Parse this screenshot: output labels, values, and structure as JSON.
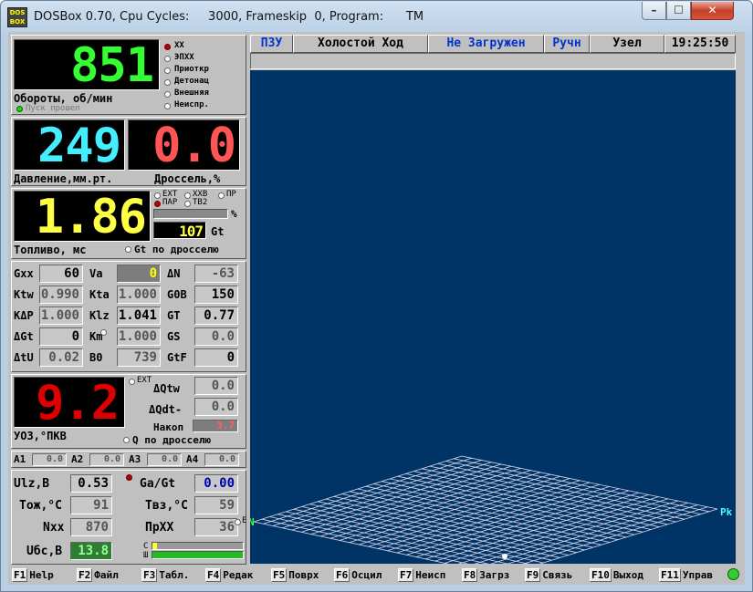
{
  "window": {
    "title": "DOSBox 0.70, Cpu Cycles:     3000, Frameskip  0, Program:      TM",
    "icon_text": "DOS BOX",
    "minimize": "–",
    "maximize": "☐",
    "close": "✕"
  },
  "rpm": {
    "value": "851",
    "label": "Обороты, об/мин",
    "start_label": "Пуск прошел"
  },
  "modes": [
    "ХХ",
    "ЭПХХ",
    "Приоткр",
    "Детонац",
    "Внешняя",
    "Неиспр."
  ],
  "pressure": {
    "value": "249",
    "label": "Давление,мм.рт."
  },
  "throttle": {
    "value": "0.0",
    "label": "Дроссель,%"
  },
  "fuel": {
    "value": "1.86",
    "label": "Топливо, мс",
    "options": [
      "EXT",
      "ХХВ",
      "ПР",
      "ПАР",
      "ТВ2"
    ],
    "percent_sign": "%",
    "gt_value": "107",
    "gt_label": "Gt",
    "gt_throttle": "Gt по дросселю"
  },
  "params": [
    {
      "label": "Gxx",
      "value": "60"
    },
    {
      "label": "Va",
      "value": "0"
    },
    {
      "label": "ΔN",
      "value": "-63"
    },
    {
      "label": "Ktw",
      "value": "0.990"
    },
    {
      "label": "Kta",
      "value": "1.000"
    },
    {
      "label": "G0B",
      "value": "150"
    },
    {
      "label": "KΔP",
      "value": "1.000"
    },
    {
      "label": "Klz",
      "value": "1.041"
    },
    {
      "label": "GT",
      "value": "0.77"
    },
    {
      "label": "ΔGt",
      "value": "0"
    },
    {
      "label": "Km",
      "value": "1.000"
    },
    {
      "label": "GS",
      "value": "0.0"
    },
    {
      "label": "ΔtU",
      "value": "0.02"
    },
    {
      "label": "B0",
      "value": "739"
    },
    {
      "label": "GtF",
      "value": "0"
    }
  ],
  "ignition": {
    "value": "9.2",
    "label": "УОЗ,°ПКВ",
    "ext": "EXT",
    "dqtw_label": "ΔQtw",
    "dqtw": "0.0",
    "dqdt_label": "ΔQdt-",
    "dqdt": "0.0",
    "nakop_label": "Накоп",
    "nakop": "3.7",
    "q_throttle": "Q по дросселю"
  },
  "analog": [
    {
      "label": "A1",
      "value": "0.0"
    },
    {
      "label": "A2",
      "value": "0.0"
    },
    {
      "label": "A3",
      "value": "0.0"
    },
    {
      "label": "A4",
      "value": "0.0"
    }
  ],
  "sensors": [
    {
      "label": "Ulz,B",
      "value": "0.53"
    },
    {
      "label": "Ga/Gt",
      "value": "0.00"
    },
    {
      "label": "Tож,°C",
      "value": "91"
    },
    {
      "label": "Tвз,°C",
      "value": "59"
    },
    {
      "label": "Nxx",
      "value": "870"
    },
    {
      "label": "ПрХХ",
      "value": "36"
    },
    {
      "label": "Uбс,B",
      "value": "13.8"
    }
  ],
  "sensor_e": "E",
  "bars": {
    "c_label": "С",
    "w_label": "Ш",
    "c_level": 0.05,
    "w_level": 1.0
  },
  "status": {
    "pzu": "ПЗУ",
    "mode": "Холостой Ход",
    "load": "Не Загружен",
    "manual": "Ручн",
    "node": "Узел",
    "time": "19:25:50"
  },
  "view": {
    "axis_pk": "Pk",
    "axis_n": "N",
    "axis_o": "0"
  },
  "fkeys": [
    {
      "key": "F1",
      "label": "Help"
    },
    {
      "key": "F2",
      "label": "Файл"
    },
    {
      "key": "F3",
      "label": "Табл."
    },
    {
      "key": "F4",
      "label": "Редак"
    },
    {
      "key": "F5",
      "label": "Поврх"
    },
    {
      "key": "F6",
      "label": "Осцил"
    },
    {
      "key": "F7",
      "label": "Неисп"
    },
    {
      "key": "F8",
      "label": "Загрз"
    },
    {
      "key": "F9",
      "label": "Связь"
    },
    {
      "key": "F10",
      "label": "Выход"
    },
    {
      "key": "F11",
      "label": "Управ"
    }
  ]
}
